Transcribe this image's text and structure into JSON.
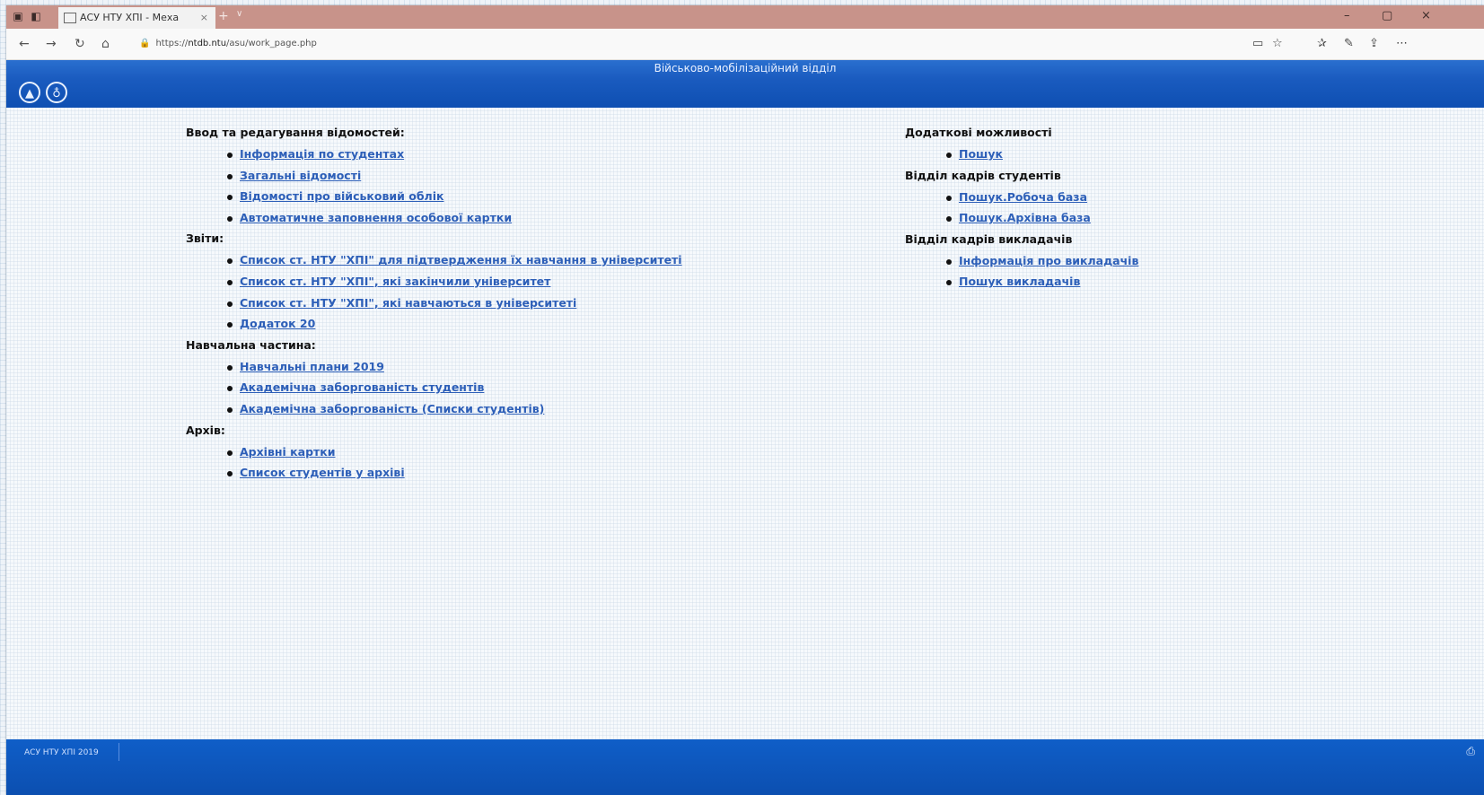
{
  "browser": {
    "tab_title": "АСУ НТУ ХПІ - Меха",
    "tab_close": "×",
    "new_tab": "+",
    "tab_dropdown": "∨",
    "url_prefix": "https://",
    "url_host": "ntdb.ntu",
    "url_path": "/asu/work_page.php",
    "win_min": "–",
    "win_max": "▢",
    "win_close": "×",
    "icons": {
      "back": "←",
      "forward": "→",
      "refresh": "↻",
      "home": "⌂",
      "lock": "🔒",
      "reading": "▭",
      "favorite": "☆",
      "favorites_hub": "✰",
      "profile": "✎",
      "share": "⇪",
      "more": "⋯"
    }
  },
  "page": {
    "banner_title": "Військово-мобілізаційний відділ",
    "banner_buttons": [
      {
        "icon": "home-triangle-icon",
        "glyph": "⌂"
      },
      {
        "icon": "bulb-icon",
        "glyph": "✪"
      }
    ]
  },
  "left": {
    "sections": [
      {
        "header": "Ввод та редагування відомостей:",
        "links": [
          "Інформація по студентах",
          "Загальні відомості",
          "Відомості про військовий облік",
          "Автоматичне заповнення особової картки"
        ]
      },
      {
        "header": "Звіти:",
        "links": [
          "Список ст. НТУ \"ХПІ\" для підтвердження їх навчання в університеті",
          "Список ст. НТУ \"ХПІ\", які закінчили університет",
          "Список ст. НТУ \"ХПІ\", які навчаються в університеті",
          "Додаток 20"
        ]
      },
      {
        "header": "Навчальна частина:",
        "links": [
          "Навчальні плани 2019",
          "Академічна заборгованість студентів",
          "Академічна заборгованість (Списки студентів)"
        ]
      },
      {
        "header": "Архів:",
        "links": [
          "Архівні картки",
          "Список студентів у архіві"
        ]
      }
    ]
  },
  "right": {
    "sections": [
      {
        "header": "Додаткові можливості",
        "links": [
          "Пошук"
        ]
      },
      {
        "header": "Відділ кадрів студентів",
        "links": [
          "Пошук.Робоча база",
          "Пошук.Архівна база"
        ]
      },
      {
        "header": "Відділ кадрів викладачів",
        "links": [
          "Інформація про викладачів",
          "Пошук викладачів"
        ]
      }
    ]
  },
  "status": {
    "text": "АСУ НТУ ХПІ 2019",
    "icon": "⎙"
  }
}
